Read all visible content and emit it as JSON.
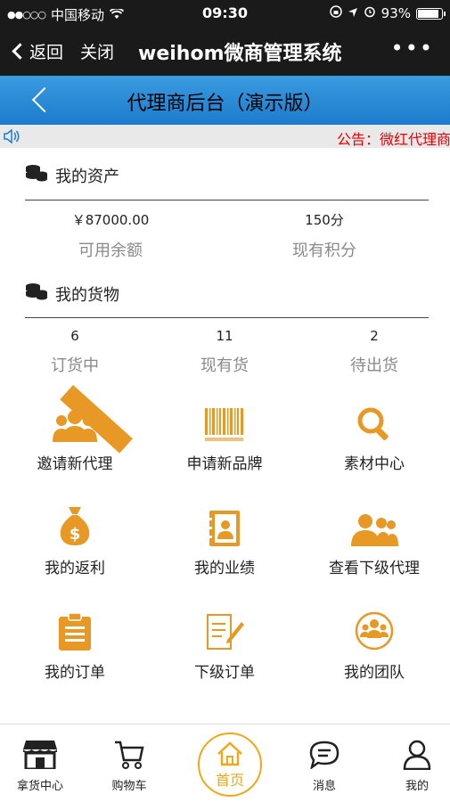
{
  "status_bar": {
    "carrier": "中国移动",
    "time": "09:30",
    "battery": "93%",
    "battery_level": 0.93
  },
  "wechat_nav": {
    "back_label": "返回",
    "close_label": "关闭",
    "title": "weihom微商管理系统",
    "more_label": "•••"
  },
  "app_header": {
    "title": "代理商后台（演示版）"
  },
  "notice": {
    "text": "公告：微红代理商"
  },
  "assets": {
    "heading": "我的资产",
    "balance_value": "￥87000.00",
    "balance_label": "可用余额",
    "points_value": "150分",
    "points_label": "现有积分"
  },
  "goods": {
    "heading": "我的货物",
    "items": [
      {
        "value": "6",
        "label": "订货中"
      },
      {
        "value": "11",
        "label": "现有货"
      },
      {
        "value": "2",
        "label": "待出货"
      }
    ]
  },
  "menu": {
    "items": [
      {
        "label": "邀请新代理",
        "icon": "users-icon"
      },
      {
        "label": "申请新品牌",
        "icon": "barcode-icon"
      },
      {
        "label": "素材中心",
        "icon": "search-icon"
      },
      {
        "label": "我的返利",
        "icon": "money-bag-icon"
      },
      {
        "label": "我的业绩",
        "icon": "contact-book-icon"
      },
      {
        "label": "查看下级代理",
        "icon": "team-icon"
      },
      {
        "label": "我的订单",
        "icon": "clipboard-icon"
      },
      {
        "label": "下级订单",
        "icon": "edit-doc-icon"
      },
      {
        "label": "我的团队",
        "icon": "group-circle-icon"
      }
    ]
  },
  "tabbar": {
    "items": [
      {
        "label": "拿货中心",
        "icon": "store-icon"
      },
      {
        "label": "购物车",
        "icon": "cart-icon"
      },
      {
        "label": "首页",
        "icon": "home-icon"
      },
      {
        "label": "消息",
        "icon": "message-icon"
      },
      {
        "label": "我的",
        "icon": "user-icon"
      }
    ]
  },
  "colors": {
    "accent": "#e89824",
    "header_blue": "#1c7ccc",
    "notice_red": "#ee0000",
    "home_yellow": "#f0a818"
  }
}
